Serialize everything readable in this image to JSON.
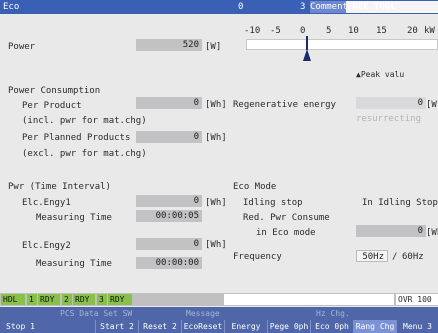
{
  "titlebar": {
    "screen": "Eco",
    "num": "0",
    "num2": "3",
    "comment": "Comment",
    "free": "FREE TOOL"
  },
  "power": {
    "label": "Power",
    "value": "520",
    "unit": "[W]",
    "scale": [
      "-10",
      "-5",
      "0",
      "5",
      "10",
      "15",
      "20",
      "kW"
    ],
    "peak": "▲Peak valu"
  },
  "consumption": {
    "title": "Power Consumption",
    "per_product": "Per Product",
    "per_product_value": "0",
    "per_product_unit": "[Wh]",
    "incl": "(incl. pwr for mat.chg)",
    "regen": "Regenerative energy",
    "regen_value": "0",
    "regen_unit": "[W]",
    "resurrecting": "resurrecting",
    "per_planned": "Per Planned Products",
    "per_planned_value": "0",
    "per_planned_unit": "[Wh]",
    "excl": "(excl. pwr for mat.chg)"
  },
  "interval": {
    "title": "Pwr (Time Interval)",
    "e1_label": "Elc.Engy1",
    "e1_value": "0",
    "e1_unit": "[Wh]",
    "mt1_label": "Measuring Time",
    "mt1_value": "00:00:05",
    "e2_label": "Elc.Engy2",
    "e2_value": "0",
    "e2_unit": "[Wh]",
    "mt2_label": "Measuring Time",
    "mt2_value": "00:00:00"
  },
  "eco": {
    "title": "Eco Mode",
    "idling": "Idling stop",
    "idling_value": "In Idling Stop",
    "red": "Red. Pwr Consume",
    "in_eco": "in Eco mode",
    "in_eco_value": "0",
    "in_eco_unit": "[Wh",
    "freq_label": "Frequency",
    "freq_50": "50Hz",
    "freq_sep": "/",
    "freq_60": "60Hz"
  },
  "status": {
    "hdl": "HDL",
    "rdy1": "1",
    "rdy1b": "RDY",
    "rdy2": "2",
    "rdy2b": "RDY",
    "rdy3": "3",
    "rdy3b": "RDY",
    "ovr": "OVR 100"
  },
  "softkeys_top": [
    "PCS Data Set SW",
    "Message",
    "Hz Chg."
  ],
  "softkeys": [
    "Stop 1",
    "Start 2",
    "Reset 2",
    "EcoReset",
    "Energy",
    "Pege 0ph",
    "Eco 0ph",
    "Rang Chg",
    "Menu 3"
  ]
}
